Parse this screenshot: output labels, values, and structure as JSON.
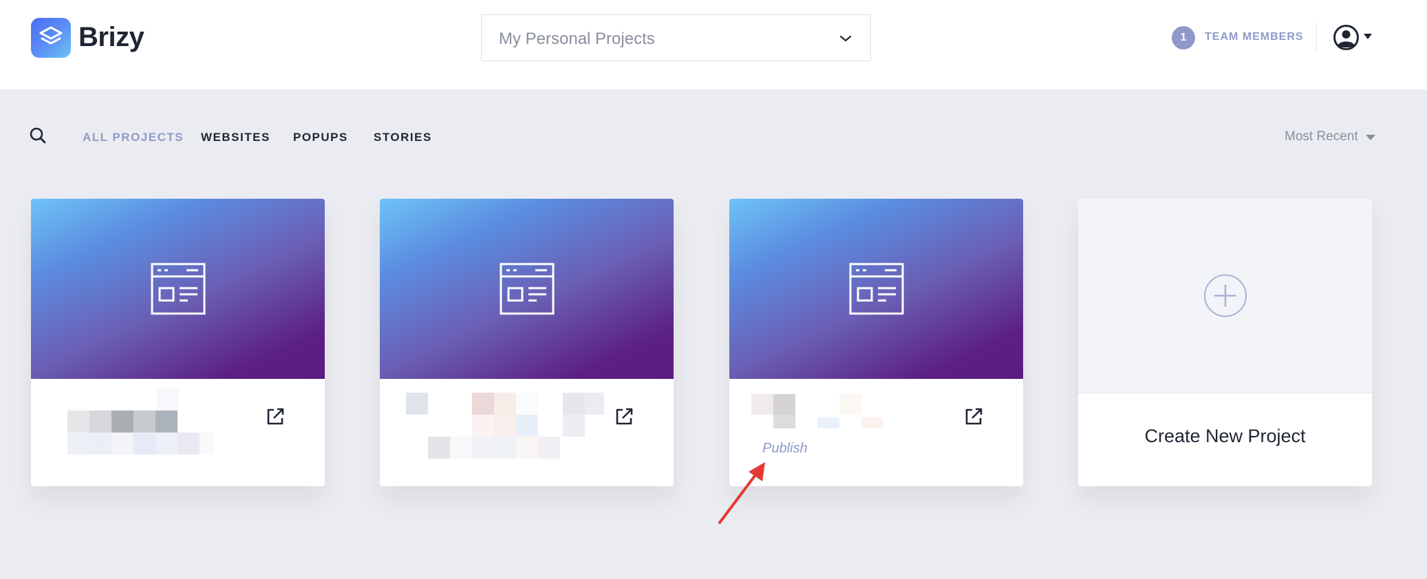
{
  "header": {
    "brand": "Brizy",
    "project_selector": {
      "value": "My Personal Projects",
      "icon": "chevron-down-icon"
    },
    "team": {
      "count": "1",
      "label": "TEAM MEMBERS"
    },
    "avatar_icon": "user-avatar-icon"
  },
  "filters": {
    "items": [
      {
        "label": "ALL PROJECTS",
        "active": true
      },
      {
        "label": "WEBSITES",
        "active": false
      },
      {
        "label": "POPUPS",
        "active": false
      },
      {
        "label": "STORIES",
        "active": false
      }
    ],
    "sort": {
      "value": "Most Recent"
    }
  },
  "projects": [
    {
      "name_hidden": true,
      "publish": ""
    },
    {
      "name_hidden": true,
      "publish": ""
    },
    {
      "name_hidden": true,
      "publish": "Publish"
    }
  ],
  "new_project": {
    "label": "Create New Project"
  },
  "colors": {
    "accent": "#8f9ac9",
    "text": "#1f2533",
    "background": "#ebecf1",
    "annotation_arrow": "#e53935"
  }
}
